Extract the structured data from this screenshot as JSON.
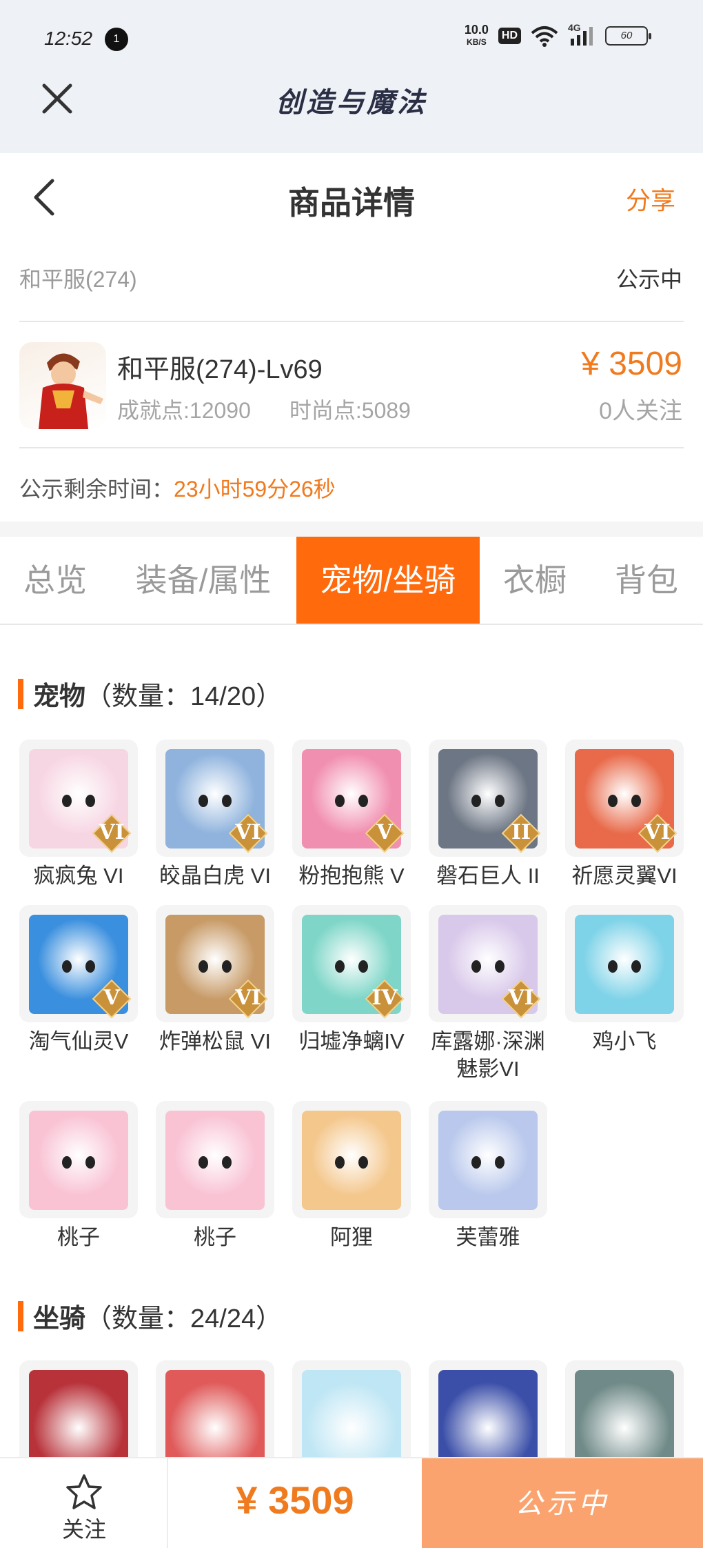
{
  "status_bar": {
    "time": "12:52",
    "notification_badge": "1",
    "net_speed_value": "10.0",
    "net_speed_unit": "KB/S",
    "hd_badge": "HD",
    "network_type": "4G",
    "battery": "60"
  },
  "app_bar": {
    "title": "创造与魔法"
  },
  "header": {
    "title": "商品详情",
    "share_label": "分享"
  },
  "server": {
    "name": "和平服(274)",
    "status": "公示中"
  },
  "item": {
    "name": "和平服(274)-Lv69",
    "achievement_label": "成就点:12090",
    "fashion_label": "时尚点:5089",
    "price": "¥ 3509",
    "followers": "0人关注"
  },
  "remaining": {
    "label": "公示剩余时间：",
    "value": "23小时59分26秒"
  },
  "tabs": [
    {
      "label": "总览",
      "active": false
    },
    {
      "label": "装备/属性",
      "active": false
    },
    {
      "label": "宠物/坐骑",
      "active": true
    },
    {
      "label": "衣橱",
      "active": false
    },
    {
      "label": "背包",
      "active": false
    }
  ],
  "pets_section": {
    "title": "宠物",
    "count": "（数量：14/20）",
    "items": [
      {
        "name": "疯疯兔 VI",
        "grade": "VI",
        "color": "#f7d6e3"
      },
      {
        "name": "皎晶白虎 VI",
        "grade": "VI",
        "color": "#8fb3dd"
      },
      {
        "name": "粉抱抱熊 V",
        "grade": "V",
        "color": "#f18fb0"
      },
      {
        "name": "磐石巨人 II",
        "grade": "II",
        "color": "#6d7684"
      },
      {
        "name": "祈愿灵翼VI",
        "grade": "VI",
        "color": "#e86a4a"
      },
      {
        "name": "淘气仙灵V",
        "grade": "V",
        "color": "#3a8fde"
      },
      {
        "name": "炸弹松鼠 VI",
        "grade": "VI",
        "color": "#c79a66"
      },
      {
        "name": "归墟净螭IV",
        "grade": "IV",
        "color": "#7fd6c8"
      },
      {
        "name": "库露娜·深渊魅影VI",
        "grade": "VI",
        "color": "#d8c8ea"
      },
      {
        "name": "鸡小飞",
        "grade": "",
        "color": "#7fd3e8"
      },
      {
        "name": "桃子",
        "grade": "",
        "color": "#f9c3d4"
      },
      {
        "name": "桃子",
        "grade": "",
        "color": "#f9c3d4"
      },
      {
        "name": "阿狸",
        "grade": "",
        "color": "#f4c78c"
      },
      {
        "name": "芙蕾雅",
        "grade": "",
        "color": "#b9c8ec"
      }
    ]
  },
  "mounts_section": {
    "title": "坐骑",
    "count": "（数量：24/24）",
    "items": [
      {
        "color": "#b8323a"
      },
      {
        "color": "#e05a5a"
      },
      {
        "color": "#bfe6f4"
      },
      {
        "color": "#3b4fa8"
      },
      {
        "color": "#6f8a88"
      }
    ]
  },
  "bottom_bar": {
    "follow_label": "关注",
    "price": "¥ 3509",
    "action_label": "公示中"
  }
}
